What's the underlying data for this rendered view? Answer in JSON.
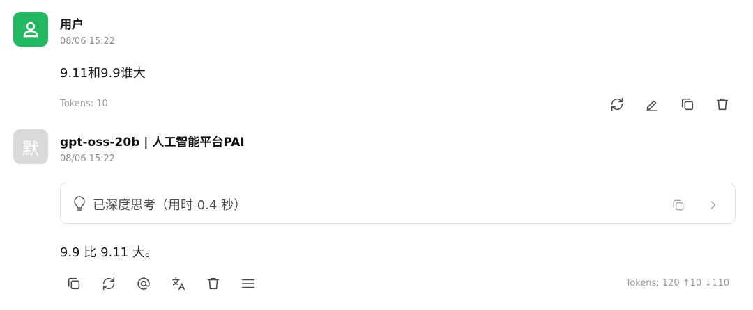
{
  "messages": {
    "user": {
      "name": "用户",
      "time": "08/06 15:22",
      "content": "9.11和9.9谁大",
      "tokens": "Tokens: 10",
      "avatar_color": "#22b862",
      "avatar_icon": "user-icon",
      "actions": [
        "refresh-icon",
        "edit-icon",
        "copy-icon",
        "delete-icon"
      ]
    },
    "assistant": {
      "name": "gpt-oss-20b | 人工智能平台PAI",
      "avatar_char": "默",
      "time": "08/06 15:22",
      "thinking": {
        "label": "已深度思考（用时 0.4 秒）",
        "icons": [
          "lightbulb-icon",
          "copy-icon",
          "chevron-right-icon"
        ]
      },
      "content": "9.9 比 9.11 大。",
      "tokens": "Tokens: 120 ↑10 ↓110",
      "actions": [
        "copy-icon",
        "refresh-icon",
        "mention-icon",
        "translate-icon",
        "delete-icon",
        "menu-icon"
      ]
    }
  },
  "colors": {
    "accent_green": "#22b862",
    "avatar_gray": "#d9d9d9",
    "muted_text": "#8a8a8a"
  }
}
